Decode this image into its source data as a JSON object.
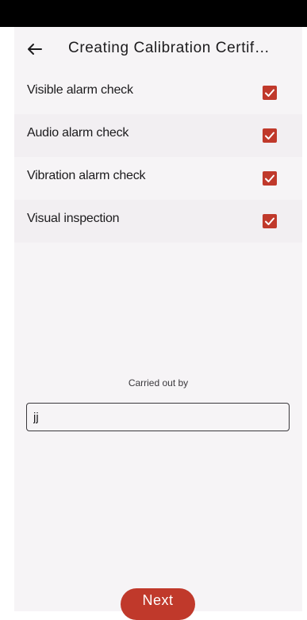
{
  "header": {
    "title": "Creating Calibration Certif…",
    "back_icon": "arrow-left-icon"
  },
  "checklist": [
    {
      "label": "Visible alarm check",
      "checked": true
    },
    {
      "label": "Audio alarm check",
      "checked": true
    },
    {
      "label": "Vibration alarm check",
      "checked": true
    },
    {
      "label": "Visual inspection",
      "checked": true
    }
  ],
  "carried_out_by": {
    "label": "Carried out by",
    "value": "jj"
  },
  "footer": {
    "next_label": "Next"
  },
  "colors": {
    "accent": "#c0392b",
    "background": "#f6f4f6",
    "status_bar": "#000000"
  }
}
